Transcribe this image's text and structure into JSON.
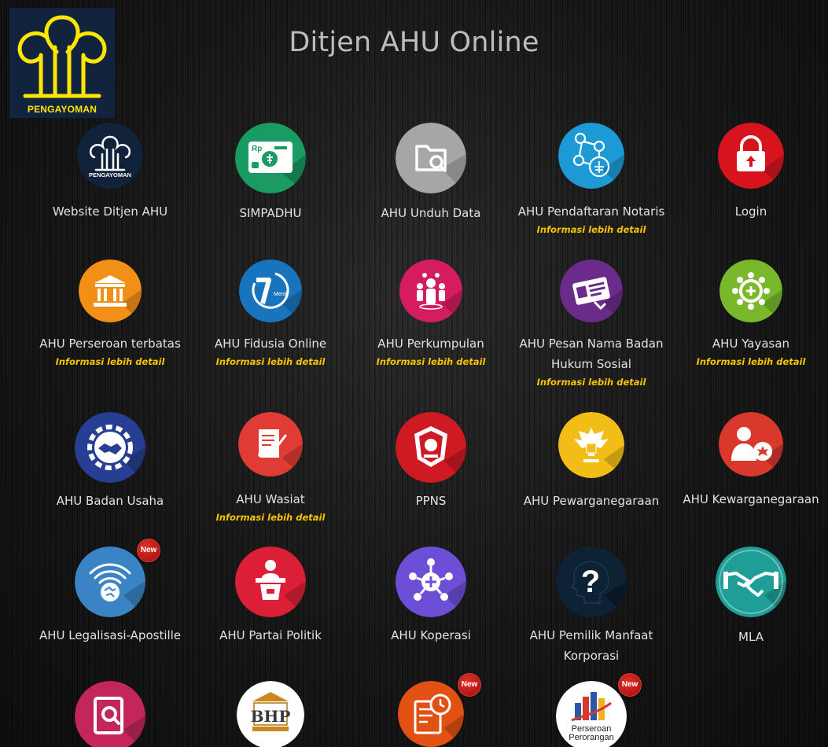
{
  "header": {
    "logo_text": "PENGAYOMAN",
    "title": "Ditjen AHU Online"
  },
  "info_text": "Informasi lebih detail",
  "badge_text": "New",
  "colors": {
    "website": "#10233b",
    "simpadhu": "#1a9b63",
    "unduh": "#a6a6a6",
    "notaris": "#1d9ad6",
    "login": "#d7141e",
    "pt": "#f28f16",
    "fidusia": "#1875bd",
    "perkumpulan": "#d41c5e",
    "pesan": "#6a2b8a",
    "yayasan": "#78b82a",
    "badan_usaha": "#263f92",
    "wasiat": "#e03b34",
    "ppns": "#cf1a24",
    "pewarganegaraan": "#f1bd16",
    "kewarganegaraan": "#d9382d",
    "apostille": "#3a84c6",
    "partai": "#dc1f37",
    "koperasi": "#6c4fd6",
    "pemilik": "#0e2236",
    "mla": "#1e9e96",
    "row6_1": "#c2265a",
    "bhp": "#ffffff",
    "row6_3": "#e25114",
    "perorangan": "#ffffff"
  },
  "tiles": [
    {
      "label": "Website Ditjen AHU",
      "icon": "pengayoman-icon"
    },
    {
      "label": "SIMPADHU",
      "icon": "payment-card-icon"
    },
    {
      "label": "AHU Unduh Data",
      "icon": "folder-search-icon"
    },
    {
      "label": "AHU Pendaftaran Notaris",
      "icon": "network-icon"
    },
    {
      "label": "Login",
      "icon": "lock-icon"
    },
    {
      "label": "AHU Perseroan terbatas",
      "icon": "building-icon"
    },
    {
      "label": "AHU Fidusia Online",
      "icon": "seven-minute-icon",
      "icon_text": "Menit"
    },
    {
      "label": "AHU Perkumpulan",
      "icon": "people-icon"
    },
    {
      "label": "AHU Pesan Nama Badan Hukum Sosial",
      "icon": "id-card-icon"
    },
    {
      "label": "AHU Yayasan",
      "icon": "community-icon"
    },
    {
      "label": "AHU Badan Usaha",
      "icon": "handshake-gear-icon"
    },
    {
      "label": "AHU Wasiat",
      "icon": "scroll-icon"
    },
    {
      "label": "PPNS",
      "icon": "police-badge-icon"
    },
    {
      "label": "AHU Pewarganegaraan",
      "icon": "garuda-icon"
    },
    {
      "label": "AHU Kewarganegaraan",
      "icon": "person-emblem-icon"
    },
    {
      "label": "AHU Legalisasi-Apostille",
      "icon": "globe-signal-icon"
    },
    {
      "label": "AHU Partai Politik",
      "icon": "podium-icon"
    },
    {
      "label": "AHU Koperasi",
      "icon": "cooperative-icon"
    },
    {
      "label": "AHU Pemilik Manfaat Korporasi",
      "icon": "question-head-icon"
    },
    {
      "label": "MLA",
      "icon": "handshake-icon"
    },
    {
      "label": "",
      "icon": "book-search-icon"
    },
    {
      "label": "",
      "icon": "bhp-icon",
      "icon_text": "BHP"
    },
    {
      "label": "",
      "icon": "document-clock-icon"
    },
    {
      "label": "",
      "icon": "perseroan-perorangan-icon",
      "icon_text": "Perseroan Perorangan"
    }
  ]
}
